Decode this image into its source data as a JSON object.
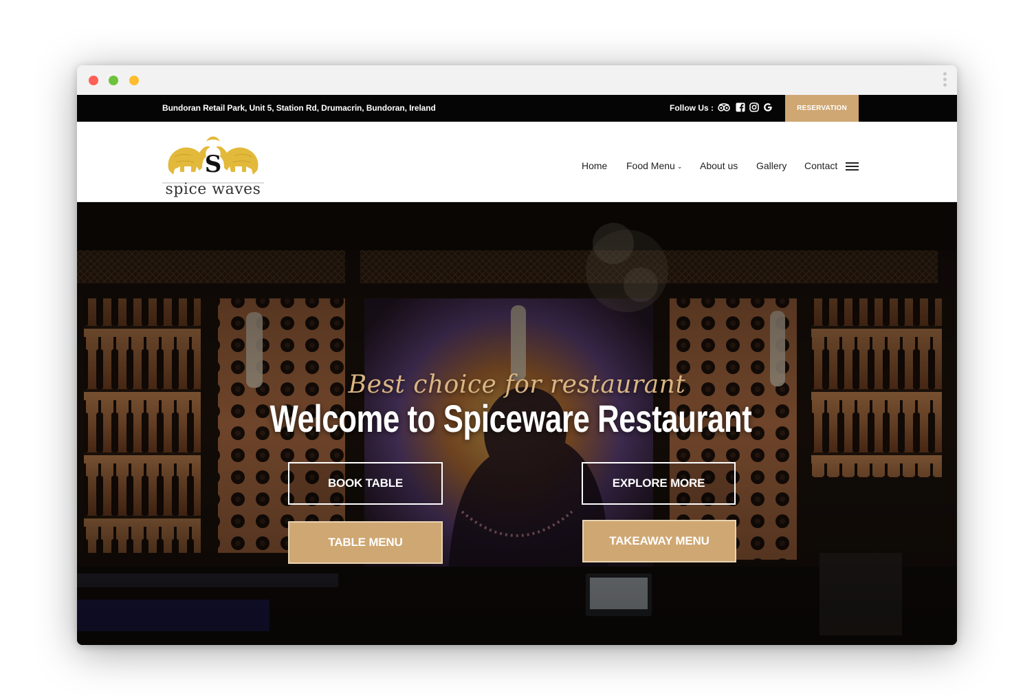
{
  "topbar": {
    "address": "Bundoran Retail Park, Unit 5, Station Rd, Drumacrin, Bundoran, Ireland",
    "follow_label": "Follow Us :",
    "social_icons": [
      "tripadvisor-icon",
      "facebook-icon",
      "instagram-icon",
      "google-icon"
    ],
    "reservation_label": "RESERVATION"
  },
  "brand": {
    "logo_text": "spice waves",
    "logo_letter": "S"
  },
  "nav": {
    "items": [
      {
        "label": "Home"
      },
      {
        "label": "Food Menu",
        "has_dropdown": true
      },
      {
        "label": "About us"
      },
      {
        "label": "Gallery"
      },
      {
        "label": "Contact"
      }
    ]
  },
  "hero": {
    "tagline": "Best choice for restaurant",
    "headline": "Welcome to Spiceware Restaurant",
    "buttons": {
      "book_table": "BOOK TABLE",
      "explore_more": "EXPLORE MORE",
      "table_menu": "TABLE MENU",
      "takeaway_menu": "TAKEAWAY MENU"
    }
  },
  "colors": {
    "accent_gold": "#cfa772",
    "topbar_bg": "#050505",
    "tagline_gold": "#d9b583"
  }
}
